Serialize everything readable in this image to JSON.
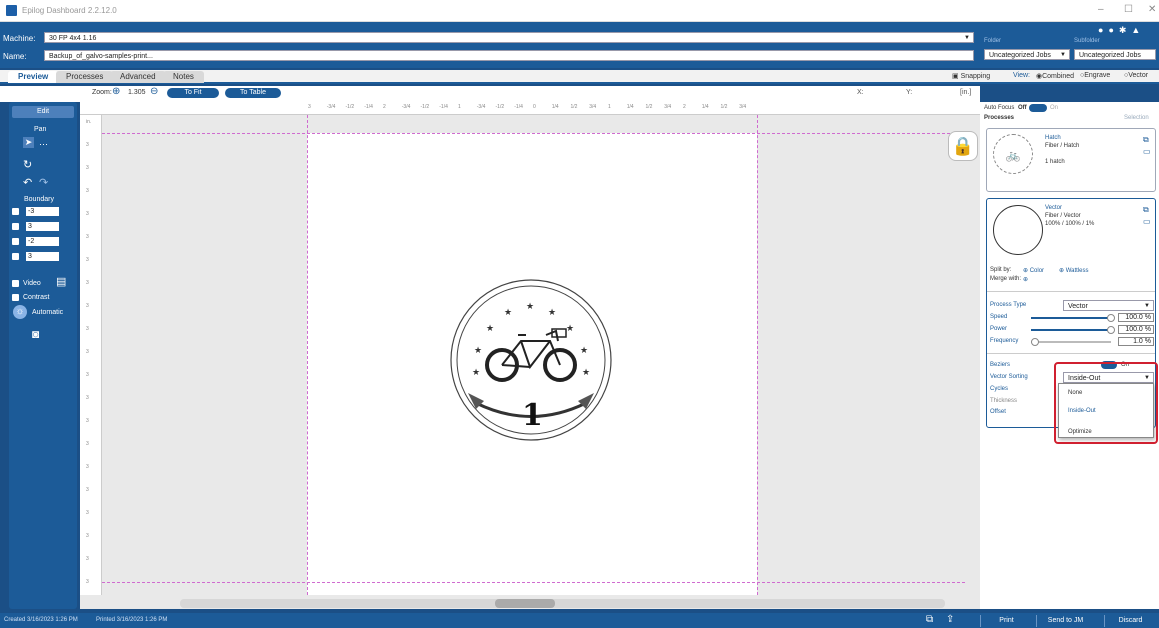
{
  "window": {
    "title": "Epilog Dashboard 2.2.12.0",
    "minimize": "–",
    "maximize": "☐",
    "close": "✕"
  },
  "machine": {
    "label": "Machine:",
    "value": "30 FP 4x4 1.16"
  },
  "name": {
    "label": "Name:",
    "value": "Backup_of_galvo-samples-print..."
  },
  "folder": {
    "label": "Folder",
    "value": "Uncategorized Jobs",
    "sub_label": "Subfolder",
    "sub_value": "Uncategorized Jobs"
  },
  "tabs": [
    "Preview",
    "Processes",
    "Advanced",
    "Notes"
  ],
  "view": {
    "snapping": "Snapping",
    "view_label": "View:",
    "combined": "Combined",
    "engrave": "Engrave",
    "vector": "Vector"
  },
  "zoom": {
    "label": "Zoom:",
    "value": "1.305",
    "to_fit": "To Fit",
    "to_table": "To Table",
    "x_label": "X:",
    "y_label": "Y:",
    "unit": "[in.]"
  },
  "left": {
    "edit": "Edit",
    "pan": "Pan",
    "boundary": "Boundary",
    "fields": [
      "-3",
      "3",
      "-2",
      "3"
    ],
    "video": "Video",
    "contrast": "Contrast",
    "automatic": "Automatic"
  },
  "ruler": {
    "top": [
      "3",
      "-3/4",
      "-1/2",
      "-1/4",
      "2",
      "-3/4",
      "-1/2",
      "-1/4",
      "1",
      "-3/4",
      "-1/2",
      "-1/4",
      "0",
      "1/4",
      "1/2",
      "3/4",
      "1",
      "1/4",
      "1/2",
      "3/4",
      "2",
      "1/4",
      "1/2",
      "3/4"
    ],
    "left": [
      "in.",
      "3",
      "3",
      "3",
      "3",
      "3",
      "3",
      "3",
      "3",
      "3",
      "3",
      "3",
      "3",
      "3",
      "3",
      "3",
      "3",
      "3",
      "3",
      "3",
      "3"
    ]
  },
  "artwork": {
    "number": "1"
  },
  "right": {
    "autofocus": "Auto Focus",
    "af_off": "Off",
    "af_on": "On",
    "processes": "Processes",
    "selection": "Selection",
    "p1": {
      "name": "Hatch",
      "type": "Fiber / Hatch",
      "detail": "1 hatch"
    },
    "p2": {
      "name": "Vector",
      "type": "Fiber / Vector",
      "detail": "100% / 100% / 1%"
    },
    "split_by": "Split by:",
    "color": "Color",
    "wattless": "Wattless",
    "merge_with": "Merge with:",
    "process_type_label": "Process Type",
    "process_type": "Vector",
    "speed_label": "Speed",
    "speed": "100.0 %",
    "power_label": "Power",
    "power": "100.0 %",
    "frequency_label": "Frequency",
    "frequency": "1.0 %",
    "beziers": "Beziers",
    "beziers_state": "On",
    "vector_sorting_label": "Vector Sorting",
    "vector_sorting": "Inside-Out",
    "cycles": "Cycles",
    "thickness": "Thickness",
    "offset": "Offset",
    "options": [
      "None",
      "Inside-Out",
      "Optimize"
    ]
  },
  "status": {
    "created": "Created 3/16/2023 1:26 PM",
    "printed": "Printed 3/16/2023 1:26 PM",
    "print": "Print",
    "send": "Send to JM",
    "discard": "Discard"
  }
}
